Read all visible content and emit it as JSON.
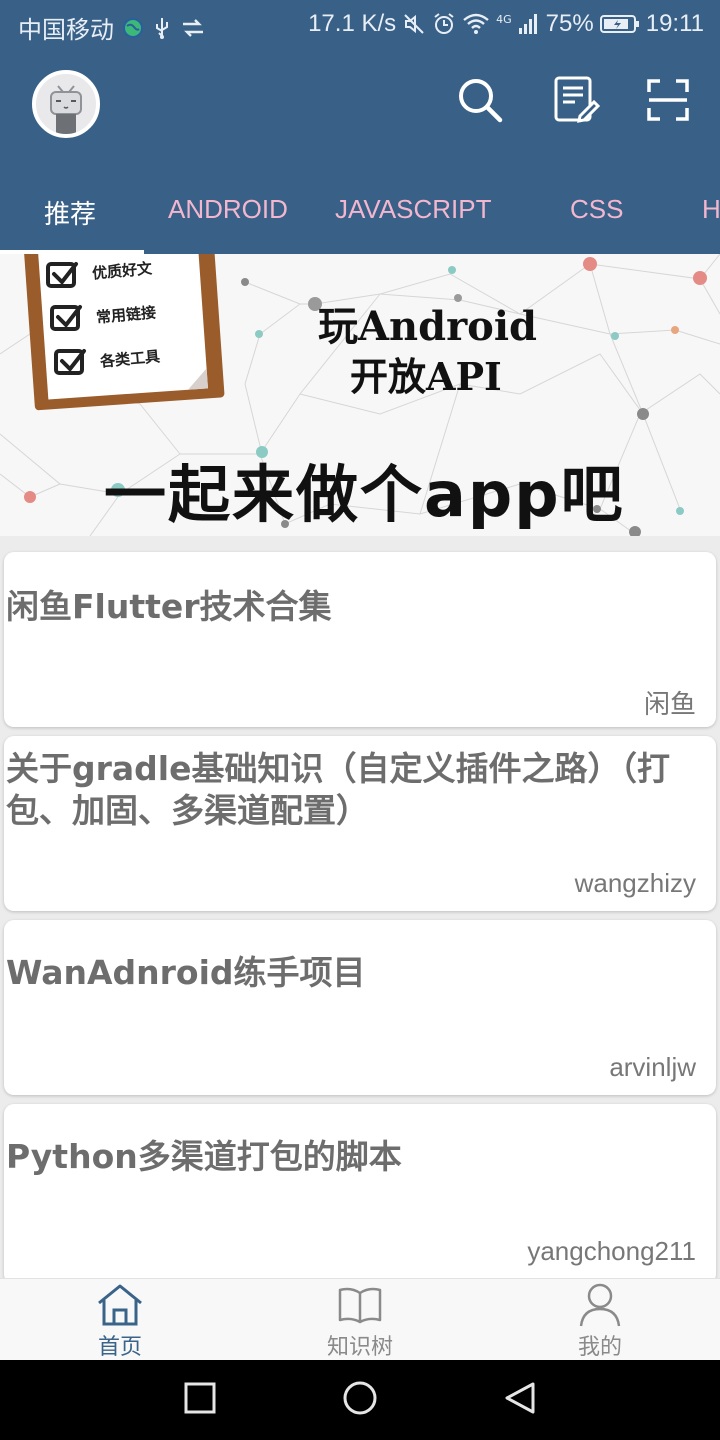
{
  "status_bar": {
    "carrier": "中国移动",
    "speed": "17.1 K/s",
    "network": "4G",
    "battery": "75%",
    "time": "19:11"
  },
  "app_bar": {
    "actions": [
      "search-icon",
      "edit-note-icon",
      "scan-icon"
    ]
  },
  "tabs": [
    {
      "label": "推荐",
      "active": true
    },
    {
      "label": "ANDROID",
      "active": false
    },
    {
      "label": "JAVASCRIPT",
      "active": false
    },
    {
      "label": "CSS",
      "active": false
    },
    {
      "label": "H",
      "active": false
    }
  ],
  "banner": {
    "checklist": [
      "优质好文",
      "常用链接",
      "各类工具"
    ],
    "title_line1": "玩Android",
    "title_line2": "开放API",
    "slogan": "一起来做个app吧"
  },
  "articles": [
    {
      "title": "闲鱼Flutter技术合集",
      "author": "闲鱼"
    },
    {
      "title": "关于gradle基础知识（自定义插件之路）（打包、加固、多渠道配置）",
      "author": "wangzhizy"
    },
    {
      "title": "WanAdnroid练手项目",
      "author": "arvinljw"
    },
    {
      "title": "Python多渠道打包的脚本",
      "author": "yangchong211"
    }
  ],
  "bottom_nav": [
    {
      "label": "首页",
      "icon": "home-icon",
      "active": true
    },
    {
      "label": "知识树",
      "icon": "book-icon",
      "active": false
    },
    {
      "label": "我的",
      "icon": "user-icon",
      "active": false
    }
  ],
  "colors": {
    "primary": "#396087",
    "tab_inactive": "#f2b7cf",
    "nav_active": "#3a6389"
  }
}
